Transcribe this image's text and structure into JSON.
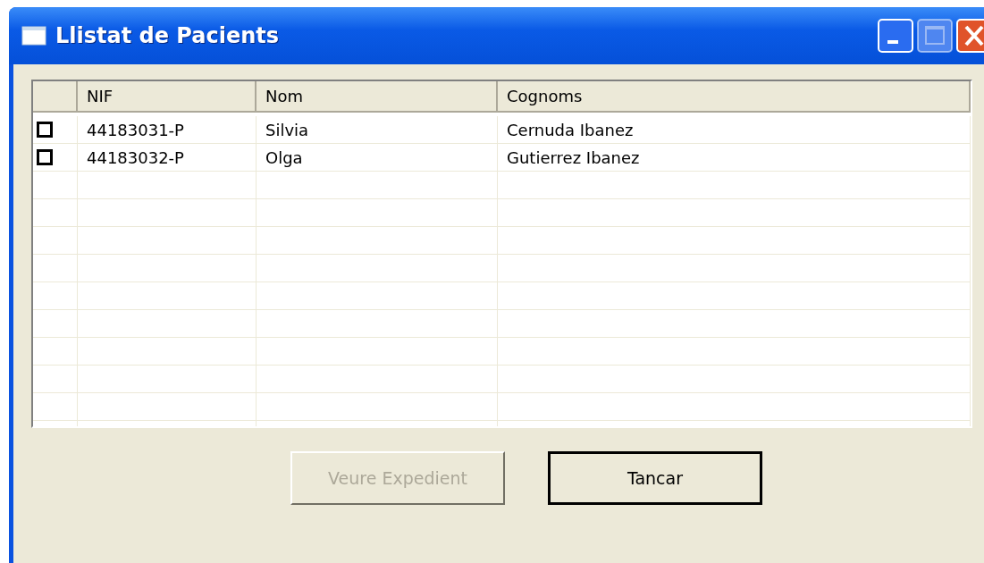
{
  "window": {
    "title": "Llistat de Pacients",
    "maximize_disabled": true
  },
  "table": {
    "columns": [
      "NIF",
      "Nom",
      "Cognoms"
    ],
    "rows": [
      {
        "checked": false,
        "cells": [
          "44183031-P",
          "Silvia",
          "Cernuda Ibanez"
        ]
      },
      {
        "checked": false,
        "cells": [
          "44183032-P",
          "Olga",
          "Gutierrez Ibanez"
        ]
      }
    ]
  },
  "buttons": [
    {
      "label": "Veure Expedient",
      "disabled": true
    },
    {
      "label": "Tancar",
      "disabled": false
    }
  ]
}
